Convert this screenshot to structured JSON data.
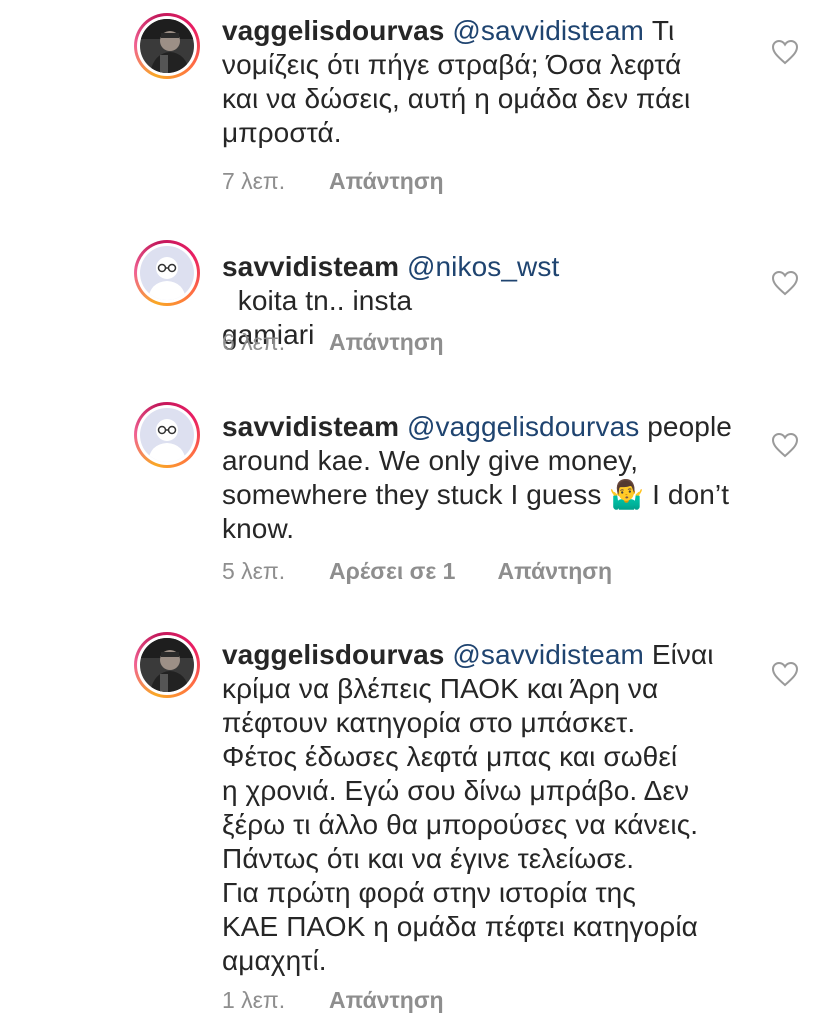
{
  "comments": [
    {
      "username": "vaggelisdourvas",
      "mention": "@savvidisteam",
      "text_lines": [
        "Τι",
        "νομίζεις ότι πήγε στραβά; Όσα λεφτά",
        "και να δώσεις, αυτή η ομάδα δεν πάει",
        "μπροστά."
      ],
      "time": "7 λεπ.",
      "likes": "",
      "reply_label": "Απάντηση",
      "avatar_icon": "profile-photo",
      "like_icon": "heart-outline-icon"
    },
    {
      "username": "savvidisteam",
      "mention": "@nikos_wst",
      "text_lines": [
        "  koita tn.. insta",
        "gamiari"
      ],
      "time": "6 λεπ.",
      "likes": "",
      "reply_label": "Απάντηση",
      "avatar_icon": "default-avatar-glasses",
      "like_icon": "heart-outline-icon"
    },
    {
      "username": "savvidisteam",
      "mention": "@vaggelisdourvas",
      "text_lines": [
        "people",
        "around kae. We only give money,",
        "somewhere they stuck I guess 🤷‍♂️ I don’t",
        "know."
      ],
      "time": "5 λεπ.",
      "likes": "Αρέσει σε 1",
      "reply_label": "Απάντηση",
      "avatar_icon": "default-avatar-glasses",
      "like_icon": "heart-outline-icon"
    },
    {
      "username": "vaggelisdourvas",
      "mention": "@savvidisteam",
      "text_lines": [
        "Είναι",
        "κρίμα να βλέπεις ΠΑΟΚ και Άρη να",
        "πέφτουν κατηγορία στο μπάσκετ.",
        "Φέτος έδωσες λεφτά μπας και σωθεί",
        "η χρονιά. Εγώ σου δίνω μπράβο. Δεν",
        "ξέρω τι άλλο θα μπορούσες να κάνεις.",
        "Πάντως ότι και να έγινε τελείωσε.",
        "Για πρώτη φορά στην ιστορία της",
        "ΚΑΕ ΠΑΟΚ η ομάδα πέφτει κατηγορία",
        "αμαχητί."
      ],
      "time": "1 λεπ.",
      "likes": "",
      "reply_label": "Απάντηση",
      "avatar_icon": "profile-photo",
      "like_icon": "heart-outline-icon"
    }
  ]
}
